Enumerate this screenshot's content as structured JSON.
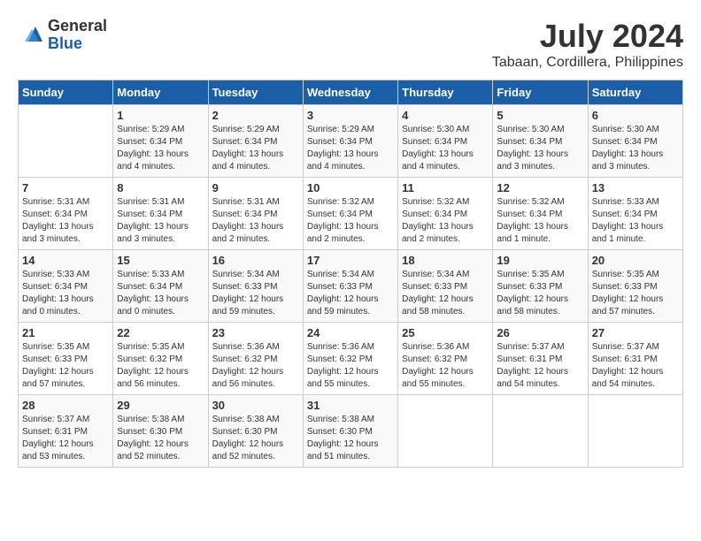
{
  "header": {
    "logo_general": "General",
    "logo_blue": "Blue",
    "month_year": "July 2024",
    "location": "Tabaan, Cordillera, Philippines"
  },
  "days_of_week": [
    "Sunday",
    "Monday",
    "Tuesday",
    "Wednesday",
    "Thursday",
    "Friday",
    "Saturday"
  ],
  "weeks": [
    [
      {
        "day": "",
        "sunrise": "",
        "sunset": "",
        "daylight": ""
      },
      {
        "day": "1",
        "sunrise": "5:29 AM",
        "sunset": "6:34 PM",
        "daylight": "13 hours and 4 minutes."
      },
      {
        "day": "2",
        "sunrise": "5:29 AM",
        "sunset": "6:34 PM",
        "daylight": "13 hours and 4 minutes."
      },
      {
        "day": "3",
        "sunrise": "5:29 AM",
        "sunset": "6:34 PM",
        "daylight": "13 hours and 4 minutes."
      },
      {
        "day": "4",
        "sunrise": "5:30 AM",
        "sunset": "6:34 PM",
        "daylight": "13 hours and 4 minutes."
      },
      {
        "day": "5",
        "sunrise": "5:30 AM",
        "sunset": "6:34 PM",
        "daylight": "13 hours and 3 minutes."
      },
      {
        "day": "6",
        "sunrise": "5:30 AM",
        "sunset": "6:34 PM",
        "daylight": "13 hours and 3 minutes."
      }
    ],
    [
      {
        "day": "7",
        "sunrise": "5:31 AM",
        "sunset": "6:34 PM",
        "daylight": "13 hours and 3 minutes."
      },
      {
        "day": "8",
        "sunrise": "5:31 AM",
        "sunset": "6:34 PM",
        "daylight": "13 hours and 3 minutes."
      },
      {
        "day": "9",
        "sunrise": "5:31 AM",
        "sunset": "6:34 PM",
        "daylight": "13 hours and 2 minutes."
      },
      {
        "day": "10",
        "sunrise": "5:32 AM",
        "sunset": "6:34 PM",
        "daylight": "13 hours and 2 minutes."
      },
      {
        "day": "11",
        "sunrise": "5:32 AM",
        "sunset": "6:34 PM",
        "daylight": "13 hours and 2 minutes."
      },
      {
        "day": "12",
        "sunrise": "5:32 AM",
        "sunset": "6:34 PM",
        "daylight": "13 hours and 1 minute."
      },
      {
        "day": "13",
        "sunrise": "5:33 AM",
        "sunset": "6:34 PM",
        "daylight": "13 hours and 1 minute."
      }
    ],
    [
      {
        "day": "14",
        "sunrise": "5:33 AM",
        "sunset": "6:34 PM",
        "daylight": "13 hours and 0 minutes."
      },
      {
        "day": "15",
        "sunrise": "5:33 AM",
        "sunset": "6:34 PM",
        "daylight": "13 hours and 0 minutes."
      },
      {
        "day": "16",
        "sunrise": "5:34 AM",
        "sunset": "6:33 PM",
        "daylight": "12 hours and 59 minutes."
      },
      {
        "day": "17",
        "sunrise": "5:34 AM",
        "sunset": "6:33 PM",
        "daylight": "12 hours and 59 minutes."
      },
      {
        "day": "18",
        "sunrise": "5:34 AM",
        "sunset": "6:33 PM",
        "daylight": "12 hours and 58 minutes."
      },
      {
        "day": "19",
        "sunrise": "5:35 AM",
        "sunset": "6:33 PM",
        "daylight": "12 hours and 58 minutes."
      },
      {
        "day": "20",
        "sunrise": "5:35 AM",
        "sunset": "6:33 PM",
        "daylight": "12 hours and 57 minutes."
      }
    ],
    [
      {
        "day": "21",
        "sunrise": "5:35 AM",
        "sunset": "6:33 PM",
        "daylight": "12 hours and 57 minutes."
      },
      {
        "day": "22",
        "sunrise": "5:35 AM",
        "sunset": "6:32 PM",
        "daylight": "12 hours and 56 minutes."
      },
      {
        "day": "23",
        "sunrise": "5:36 AM",
        "sunset": "6:32 PM",
        "daylight": "12 hours and 56 minutes."
      },
      {
        "day": "24",
        "sunrise": "5:36 AM",
        "sunset": "6:32 PM",
        "daylight": "12 hours and 55 minutes."
      },
      {
        "day": "25",
        "sunrise": "5:36 AM",
        "sunset": "6:32 PM",
        "daylight": "12 hours and 55 minutes."
      },
      {
        "day": "26",
        "sunrise": "5:37 AM",
        "sunset": "6:31 PM",
        "daylight": "12 hours and 54 minutes."
      },
      {
        "day": "27",
        "sunrise": "5:37 AM",
        "sunset": "6:31 PM",
        "daylight": "12 hours and 54 minutes."
      }
    ],
    [
      {
        "day": "28",
        "sunrise": "5:37 AM",
        "sunset": "6:31 PM",
        "daylight": "12 hours and 53 minutes."
      },
      {
        "day": "29",
        "sunrise": "5:38 AM",
        "sunset": "6:30 PM",
        "daylight": "12 hours and 52 minutes."
      },
      {
        "day": "30",
        "sunrise": "5:38 AM",
        "sunset": "6:30 PM",
        "daylight": "12 hours and 52 minutes."
      },
      {
        "day": "31",
        "sunrise": "5:38 AM",
        "sunset": "6:30 PM",
        "daylight": "12 hours and 51 minutes."
      },
      {
        "day": "",
        "sunrise": "",
        "sunset": "",
        "daylight": ""
      },
      {
        "day": "",
        "sunrise": "",
        "sunset": "",
        "daylight": ""
      },
      {
        "day": "",
        "sunrise": "",
        "sunset": "",
        "daylight": ""
      }
    ]
  ]
}
